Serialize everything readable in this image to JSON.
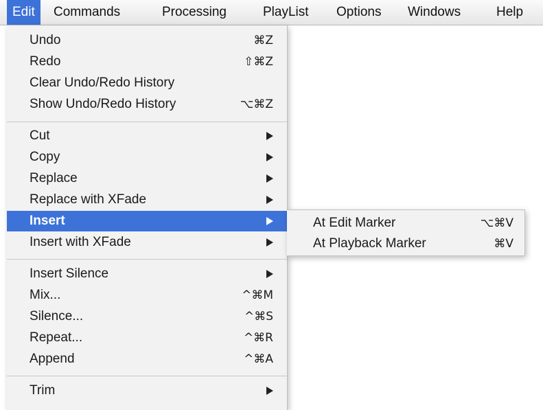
{
  "menubar": {
    "items": [
      "Edit",
      "Commands",
      "Processing",
      "PlayList",
      "Options",
      "Windows",
      "Help"
    ],
    "active": "Edit"
  },
  "edit_menu": {
    "undo": {
      "label": "Undo",
      "shortcut": "⌘Z"
    },
    "redo": {
      "label": "Redo",
      "shortcut": "⇧⌘Z"
    },
    "clear_history": {
      "label": "Clear Undo/Redo History"
    },
    "show_history": {
      "label": "Show Undo/Redo History",
      "shortcut": "⌥⌘Z"
    },
    "cut": {
      "label": "Cut"
    },
    "copy": {
      "label": "Copy"
    },
    "replace": {
      "label": "Replace"
    },
    "replace_xfade": {
      "label": "Replace with XFade"
    },
    "insert": {
      "label": "Insert"
    },
    "insert_xfade": {
      "label": "Insert with XFade"
    },
    "insert_silence": {
      "label": "Insert Silence"
    },
    "mix": {
      "label": "Mix...",
      "shortcut": "^⌘M"
    },
    "silence": {
      "label": "Silence...",
      "shortcut": "^⌘S"
    },
    "repeat": {
      "label": "Repeat...",
      "shortcut": "^⌘R"
    },
    "append": {
      "label": "Append",
      "shortcut": "^⌘A"
    },
    "trim": {
      "label": "Trim"
    }
  },
  "insert_submenu": {
    "at_edit_marker": {
      "label": "At Edit Marker",
      "shortcut": "⌥⌘V"
    },
    "at_playback_marker": {
      "label": "At Playback Marker",
      "shortcut": "⌘V"
    }
  },
  "colors": {
    "highlight": "#3d72d8",
    "menu_bg": "#f2f2f2"
  }
}
